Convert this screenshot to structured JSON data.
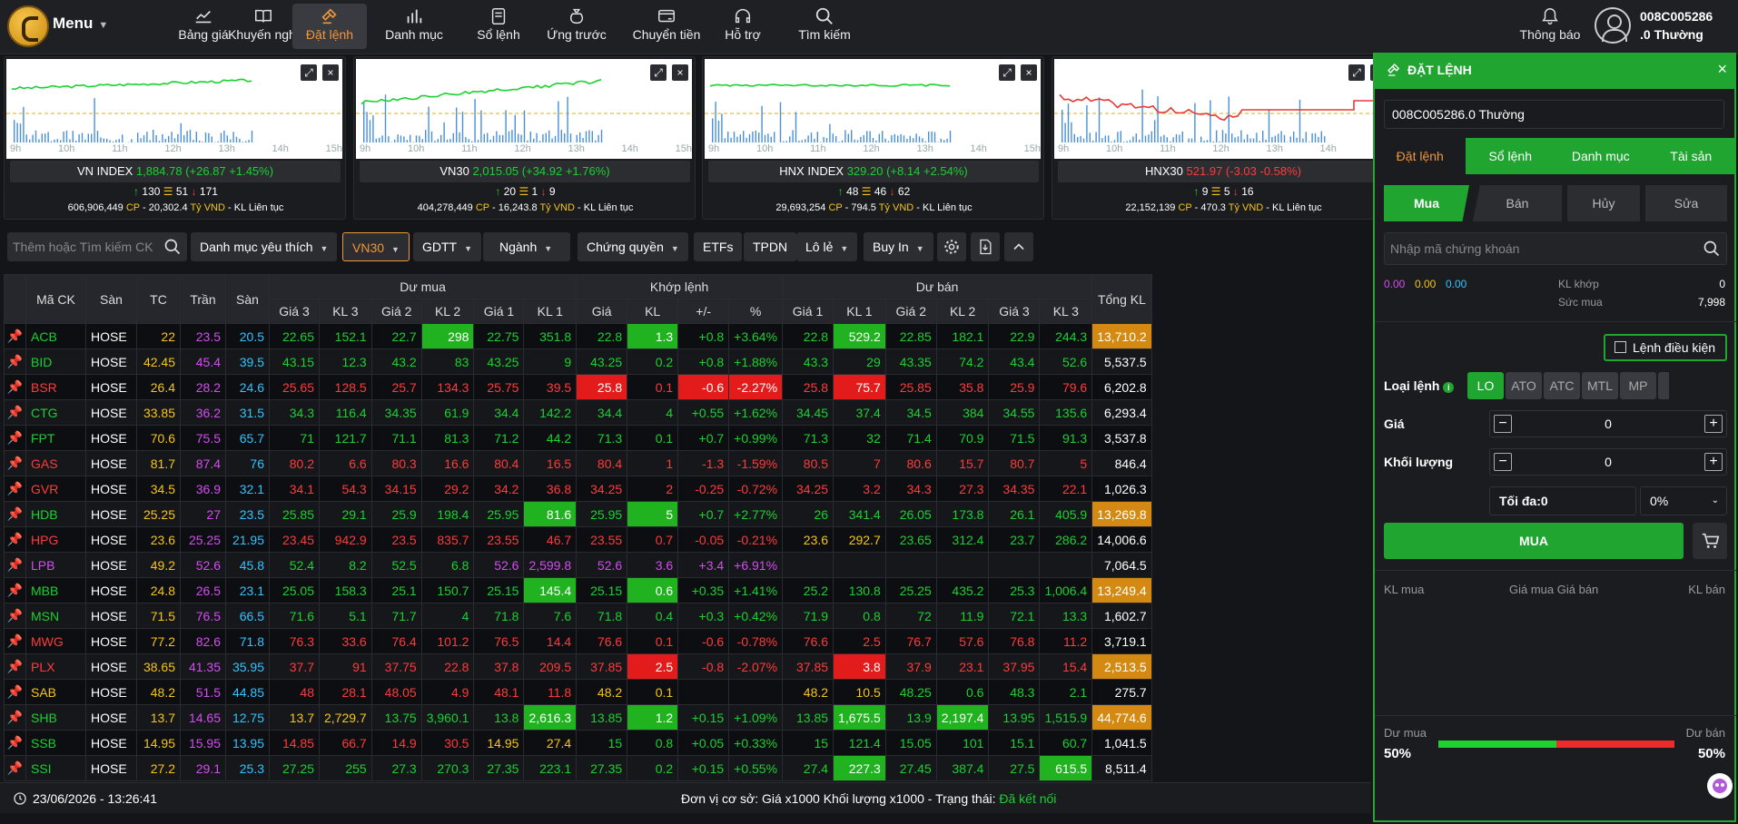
{
  "nav": {
    "menu_label": "Menu",
    "items": [
      {
        "label": "Bảng giá",
        "icon": "chart-line-icon"
      },
      {
        "label": "Khuyến nghị",
        "icon": "book-icon"
      },
      {
        "label": "Đặt lệnh",
        "icon": "gavel-icon",
        "active": true
      },
      {
        "label": "Danh mục",
        "icon": "bar-chart-icon"
      },
      {
        "label": "Sổ lệnh",
        "icon": "order-book-icon"
      },
      {
        "label": "Ứng trước",
        "icon": "money-bag-icon"
      },
      {
        "label": "Chuyển tiền",
        "icon": "transfer-icon"
      },
      {
        "label": "Hỗ trợ",
        "icon": "headset-icon"
      },
      {
        "label": "Tìm kiếm",
        "icon": "search-icon"
      }
    ],
    "notify_label": "Thông báo",
    "user_id": "008C005286",
    "user_type": ".0 Thường"
  },
  "hours": [
    "9h",
    "10h",
    "11h",
    "12h",
    "13h",
    "14h",
    "15h"
  ],
  "indices": [
    {
      "name": "VN INDEX",
      "value": "1,884.78",
      "change": "(+26.87 +1.45%)",
      "trend": "up",
      "adv": "130",
      "unch": "51",
      "dec": "171",
      "volume": "606,906,449",
      "value_text": "20,302.4",
      "unit": "Tỷ VND",
      "status": "KL Liên tục"
    },
    {
      "name": "VN30",
      "value": "2,015.05",
      "change": "(+34.92 +1.76%)",
      "trend": "up",
      "adv": "20",
      "unch": "1",
      "dec": "9",
      "volume": "404,278,449",
      "value_text": "16,243.8",
      "unit": "Tỷ VND",
      "status": "KL Liên tục"
    },
    {
      "name": "HNX INDEX",
      "value": "329.20",
      "change": "(+8.14 +2.54%)",
      "trend": "up",
      "adv": "48",
      "unch": "46",
      "dec": "62",
      "volume": "29,693,254",
      "value_text": "794.5",
      "unit": "Tỷ VND",
      "status": "KL Liên tục"
    },
    {
      "name": "HNX30",
      "value": "521.97",
      "change": "(-3.03 -0.58%)",
      "trend": "down",
      "adv": "9",
      "unch": "5",
      "dec": "16",
      "volume": "22,152,139",
      "value_text": "470.3",
      "unit": "Tỷ VND",
      "status": "KL Liên tục"
    }
  ],
  "labels": {
    "cp": "CP",
    "sep": "-"
  },
  "filters": {
    "search_placeholder": "Thêm hoặc Tìm kiếm CK",
    "favorites": "Danh mục yêu thích",
    "vn30": "VN30",
    "gdtt": "GDTT",
    "nganh": "Ngành",
    "chungquyen": "Chứng quyền",
    "etfs": "ETFs",
    "tpdn": "TPDN",
    "lole": "Lô lẻ",
    "buyin": "Buy In"
  },
  "table": {
    "h_symbol": "Mã CK",
    "h_exchange": "Sàn",
    "h_ref": "TC",
    "h_ceil": "Trần",
    "h_floor": "Sàn",
    "h_bid": "Dư mua",
    "h_match": "Khớp lệnh",
    "h_ask": "Dư bán",
    "h_total": "Tổng KL",
    "sub": [
      "Giá 3",
      "KL 3",
      "Giá 2",
      "KL 2",
      "Giá 1",
      "KL 1",
      "Giá",
      "KL",
      "+/-",
      "%",
      "Giá 1",
      "KL 1",
      "Giá 2",
      "KL 2",
      "Giá 3",
      "KL 3"
    ],
    "rows": [
      {
        "c": "u",
        "sym": "ACB",
        "ex": "HOSE",
        "tc": "22",
        "tr": "23.5",
        "sa": "20.5",
        "v": [
          "22.65",
          "152.1",
          "22.7",
          "298",
          "22.75",
          "351.8",
          "22.8",
          "1.3",
          "+0.8",
          "+3.64%",
          "22.8",
          "529.2",
          "22.85",
          "182.1",
          "22.9",
          "244.3"
        ],
        "tot": "13,710.2",
        "hl": {
          "3": "g",
          "7": "g",
          "11": "g"
        },
        "tothl": "o"
      },
      {
        "c": "u",
        "sym": "BID",
        "ex": "HOSE",
        "tc": "42.45",
        "tr": "45.4",
        "sa": "39.5",
        "v": [
          "43.15",
          "12.3",
          "43.2",
          "83",
          "43.25",
          "9",
          "43.25",
          "0.2",
          "+0.8",
          "+1.88%",
          "43.3",
          "29",
          "43.35",
          "74.2",
          "43.4",
          "52.6"
        ],
        "tot": "5,537.5",
        "hl": {}
      },
      {
        "c": "d",
        "sym": "BSR",
        "ex": "HOSE",
        "tc": "26.4",
        "tr": "28.2",
        "sa": "24.6",
        "v": [
          "25.65",
          "128.5",
          "25.7",
          "134.3",
          "25.75",
          "39.5",
          "25.8",
          "0.1",
          "-0.6",
          "-2.27%",
          "25.8",
          "75.7",
          "25.85",
          "35.8",
          "25.9",
          "79.6"
        ],
        "tot": "6,202.8",
        "hl": {
          "6": "r",
          "8": "r",
          "9": "r",
          "11": "r"
        }
      },
      {
        "c": "u",
        "sym": "CTG",
        "ex": "HOSE",
        "tc": "33.85",
        "tr": "36.2",
        "sa": "31.5",
        "v": [
          "34.3",
          "116.4",
          "34.35",
          "61.9",
          "34.4",
          "142.2",
          "34.4",
          "4",
          "+0.55",
          "+1.62%",
          "34.45",
          "37.4",
          "34.5",
          "384",
          "34.55",
          "135.6"
        ],
        "tot": "6,293.4",
        "hl": {}
      },
      {
        "c": "u",
        "sym": "FPT",
        "ex": "HOSE",
        "tc": "70.6",
        "tr": "75.5",
        "sa": "65.7",
        "v": [
          "71",
          "121.7",
          "71.1",
          "81.3",
          "71.2",
          "44.2",
          "71.3",
          "0.1",
          "+0.7",
          "+0.99%",
          "71.3",
          "32",
          "71.4",
          "70.9",
          "71.5",
          "91.3"
        ],
        "tot": "3,537.8",
        "hl": {}
      },
      {
        "c": "d",
        "sym": "GAS",
        "ex": "HOSE",
        "tc": "81.7",
        "tr": "87.4",
        "sa": "76",
        "v": [
          "80.2",
          "6.6",
          "80.3",
          "16.6",
          "80.4",
          "16.5",
          "80.4",
          "1",
          "-1.3",
          "-1.59%",
          "80.5",
          "7",
          "80.6",
          "15.7",
          "80.7",
          "5"
        ],
        "tot": "846.4",
        "hl": {}
      },
      {
        "c": "d",
        "sym": "GVR",
        "ex": "HOSE",
        "tc": "34.5",
        "tr": "36.9",
        "sa": "32.1",
        "v": [
          "34.1",
          "54.3",
          "34.15",
          "29.2",
          "34.2",
          "36.8",
          "34.25",
          "2",
          "-0.25",
          "-0.72%",
          "34.25",
          "3.2",
          "34.3",
          "27.3",
          "34.35",
          "22.1"
        ],
        "tot": "1,026.3",
        "hl": {}
      },
      {
        "c": "u",
        "sym": "HDB",
        "ex": "HOSE",
        "tc": "25.25",
        "tr": "27",
        "sa": "23.5",
        "v": [
          "25.85",
          "29.1",
          "25.9",
          "198.4",
          "25.95",
          "81.6",
          "25.95",
          "5",
          "+0.7",
          "+2.77%",
          "26",
          "341.4",
          "26.05",
          "173.8",
          "26.1",
          "405.9"
        ],
        "tot": "13,269.8",
        "hl": {
          "5": "g",
          "7": "g"
        },
        "tothl": "o"
      },
      {
        "c": "d",
        "sym": "HPG",
        "ex": "HOSE",
        "tc": "23.6",
        "tr": "25.25",
        "sa": "21.95",
        "v": [
          "23.45",
          "942.9",
          "23.5",
          "835.7",
          "23.55",
          "46.7",
          "23.55",
          "0.7",
          "-0.05",
          "-0.21%",
          "23.6",
          "292.7",
          "23.65",
          "312.4",
          "23.7",
          "286.2"
        ],
        "tot": "14,006.6",
        "hl": {}
      },
      {
        "c": "c",
        "sym": "LPB",
        "ex": "HOSE",
        "tc": "49.2",
        "tr": "52.6",
        "sa": "45.8",
        "v": [
          "52.4",
          "8.2",
          "52.5",
          "6.8",
          "52.6",
          "2,599.8",
          "52.6",
          "3.6",
          "+3.4",
          "+6.91%",
          "",
          "",
          "",
          "",
          "",
          ""
        ],
        "tot": "7,064.5",
        "hl": {}
      },
      {
        "c": "u",
        "sym": "MBB",
        "ex": "HOSE",
        "tc": "24.8",
        "tr": "26.5",
        "sa": "23.1",
        "v": [
          "25.05",
          "158.3",
          "25.1",
          "150.7",
          "25.15",
          "145.4",
          "25.15",
          "0.6",
          "+0.35",
          "+1.41%",
          "25.2",
          "130.8",
          "25.25",
          "435.2",
          "25.3",
          "1,006.4"
        ],
        "tot": "13,249.4",
        "hl": {
          "5": "g",
          "7": "g"
        },
        "tothl": "o"
      },
      {
        "c": "u",
        "sym": "MSN",
        "ex": "HOSE",
        "tc": "71.5",
        "tr": "76.5",
        "sa": "66.5",
        "v": [
          "71.6",
          "5.1",
          "71.7",
          "4",
          "71.8",
          "7.6",
          "71.8",
          "0.4",
          "+0.3",
          "+0.42%",
          "71.9",
          "0.8",
          "72",
          "11.9",
          "72.1",
          "13.3"
        ],
        "tot": "1,602.7",
        "hl": {}
      },
      {
        "c": "d",
        "sym": "MWG",
        "ex": "HOSE",
        "tc": "77.2",
        "tr": "82.6",
        "sa": "71.8",
        "v": [
          "76.3",
          "33.6",
          "76.4",
          "101.2",
          "76.5",
          "14.4",
          "76.6",
          "0.1",
          "-0.6",
          "-0.78%",
          "76.6",
          "2.5",
          "76.7",
          "57.6",
          "76.8",
          "11.2"
        ],
        "tot": "3,719.1",
        "hl": {}
      },
      {
        "c": "d",
        "sym": "PLX",
        "ex": "HOSE",
        "tc": "38.65",
        "tr": "41.35",
        "sa": "35.95",
        "v": [
          "37.7",
          "91",
          "37.75",
          "22.8",
          "37.8",
          "209.5",
          "37.85",
          "2.5",
          "-0.8",
          "-2.07%",
          "37.85",
          "3.8",
          "37.9",
          "23.1",
          "37.95",
          "15.4"
        ],
        "tot": "2,513.5",
        "hl": {
          "7": "r",
          "11": "r"
        },
        "tothl": "o"
      },
      {
        "c": "r",
        "sym": "SAB",
        "ex": "HOSE",
        "tc": "48.2",
        "tr": "51.5",
        "sa": "44.85",
        "v": [
          "48",
          "28.1",
          "48.05",
          "4.9",
          "48.1",
          "11.8",
          "48.2",
          "0.1",
          "",
          "",
          "48.2",
          "10.5",
          "48.25",
          "0.6",
          "48.3",
          "2.1"
        ],
        "tot": "275.7",
        "hl": {}
      },
      {
        "c": "u",
        "sym": "SHB",
        "ex": "HOSE",
        "tc": "13.7",
        "tr": "14.65",
        "sa": "12.75",
        "v": [
          "13.7",
          "2,729.7",
          "13.75",
          "3,960.1",
          "13.8",
          "2,616.3",
          "13.85",
          "1.2",
          "+0.15",
          "+1.09%",
          "13.85",
          "1,675.5",
          "13.9",
          "2,197.4",
          "13.95",
          "1,515.9"
        ],
        "tot": "44,774.6",
        "hl": {
          "5": "g",
          "7": "g",
          "11": "g",
          "13": "g"
        },
        "tothl": "o"
      },
      {
        "c": "u",
        "sym": "SSB",
        "ex": "HOSE",
        "tc": "14.95",
        "tr": "15.95",
        "sa": "13.95",
        "v": [
          "14.85",
          "66.7",
          "14.9",
          "30.5",
          "14.95",
          "27.4",
          "15",
          "0.8",
          "+0.05",
          "+0.33%",
          "15",
          "121.4",
          "15.05",
          "101",
          "15.1",
          "60.7"
        ],
        "tot": "1,041.5",
        "hl": {}
      },
      {
        "c": "u",
        "sym": "SSI",
        "ex": "HOSE",
        "tc": "27.2",
        "tr": "29.1",
        "sa": "25.3",
        "v": [
          "27.25",
          "255",
          "27.3",
          "270.3",
          "27.35",
          "223.1",
          "27.35",
          "0.2",
          "+0.15",
          "+0.55%",
          "27.4",
          "227.3",
          "27.45",
          "387.4",
          "27.5",
          "615.5"
        ],
        "tot": "8,511.4",
        "hl": {
          "11": "g",
          "15": "g"
        }
      }
    ]
  },
  "status": {
    "datetime": "23/06/2026 - 13:26:41",
    "unit_text": "Đơn vị cơ sở: Giá x1000 Khối lượng x1000 - Trạng thái:",
    "state": "Đã kết nối"
  },
  "order": {
    "title": "ĐẶT LỆNH",
    "account": "008C005286.0 Thường",
    "tabs": [
      "Đặt lệnh",
      "Sổ lệnh",
      "Danh mục",
      "Tài sản"
    ],
    "buy": "Mua",
    "sell": "Bán",
    "cancel": "Hủy",
    "edit": "Sửa",
    "symbol_placeholder": "Nhập mã chứng khoán",
    "q1": "0.00",
    "q2": "0.00",
    "q3": "0.00",
    "kl_khop_label": "KL khớp",
    "kl_khop": "0",
    "suc_mua_label": "Sức mua",
    "suc_mua": "7,998",
    "cond_label": "Lệnh điều kiện",
    "type_label": "Loại lệnh",
    "types": [
      "LO",
      "ATO",
      "ATC",
      "MTL",
      "MP"
    ],
    "price_label": "Giá",
    "price": "0",
    "qty_label": "Khối lượng",
    "qty": "0",
    "max": "Tối đa:0",
    "pct": "0%",
    "buy_btn": "MUA",
    "ob_buy": "KL mua",
    "ob_price": "Giá mua Giá bán",
    "ob_sell": "KL bán",
    "du_mua": "Dư mua",
    "du_ban": "Dư bán",
    "buy_pct": "50%",
    "sell_pct": "50%",
    "buy_ratio": 0.5
  }
}
